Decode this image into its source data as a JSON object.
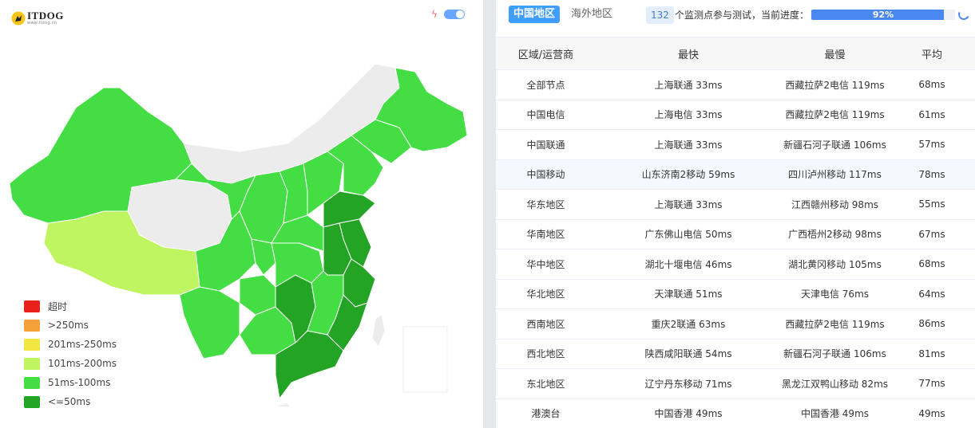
{
  "logo": {
    "name": "ITDOG",
    "sub": "www.itdog.cn"
  },
  "colors": {
    "timeout": "#e8211c",
    "over250": "#f6a03a",
    "r201_250": "#f2e643",
    "r101_200": "#c0f562",
    "r51_100": "#44de44",
    "le50": "#24a424",
    "no_data": "#ececec",
    "accent": "#409eff"
  },
  "legend": [
    {
      "label": "超时",
      "color": "#e8211c"
    },
    {
      "label": ">250ms",
      "color": "#f6a03a"
    },
    {
      "label": "201ms-250ms",
      "color": "#f2e643"
    },
    {
      "label": "101ms-200ms",
      "color": "#c0f562"
    },
    {
      "label": "51ms-100ms",
      "color": "#44de44"
    },
    {
      "label": "<=50ms",
      "color": "#24a424"
    }
  ],
  "tabs": {
    "active": "中国地区",
    "inactive": "海外地区"
  },
  "progress": {
    "count": "132",
    "text": "个监测点参与测试，当前进度：",
    "percent_label": "92%",
    "percent": 92
  },
  "table": {
    "headers": [
      "区域/运营商",
      "最快",
      "最慢",
      "平均"
    ],
    "rows": [
      [
        "全部节点",
        "上海联通 33ms",
        "西藏拉萨2电信 119ms",
        "68ms"
      ],
      [
        "中国电信",
        "上海电信 33ms",
        "西藏拉萨2电信 119ms",
        "61ms"
      ],
      [
        "中国联通",
        "上海联通 33ms",
        "新疆石河子联通 106ms",
        "57ms"
      ],
      [
        "中国移动",
        "山东济南2移动 59ms",
        "四川泸州移动 117ms",
        "78ms"
      ],
      [
        "华东地区",
        "上海联通 33ms",
        "江西赣州移动 98ms",
        "55ms"
      ],
      [
        "华南地区",
        "广东佛山电信 50ms",
        "广西梧州2移动 98ms",
        "67ms"
      ],
      [
        "华中地区",
        "湖北十堰电信 46ms",
        "湖北黄冈移动 105ms",
        "68ms"
      ],
      [
        "华北地区",
        "天津联通 51ms",
        "天津电信 76ms",
        "64ms"
      ],
      [
        "西南地区",
        "重庆2联通 63ms",
        "西藏拉萨2电信 119ms",
        "86ms"
      ],
      [
        "西北地区",
        "陕西咸阳联通 54ms",
        "新疆石河子联通 106ms",
        "81ms"
      ],
      [
        "东北地区",
        "辽宁丹东移动 71ms",
        "黑龙江双鸭山移动 82ms",
        "77ms"
      ],
      [
        "港澳台",
        "中国香港 49ms",
        "中国香港 49ms",
        "49ms"
      ]
    ]
  }
}
